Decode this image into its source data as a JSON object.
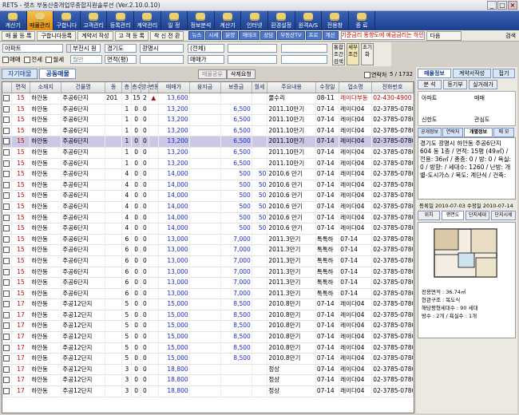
{
  "window": {
    "title": "RETS - 렛츠 부동산중개업무종합지원솔루션 (Ver.2.10.0.10)",
    "btn_min": "_",
    "btn_max": "□",
    "btn_close": "×"
  },
  "nav": [
    "계산기",
    "매물관리",
    "구합니다",
    "고객관리",
    "등록관리",
    "계약관리",
    "일 정",
    "정보분석",
    "계산기",
    "인터넷",
    "환경설정",
    "원격A/S",
    "전용창",
    "종 료"
  ],
  "subbar": {
    "b1": "매 물 등 록",
    "b2": "구합니다등록",
    "b3": "계약서 작성",
    "b4": "고 객 등 록",
    "b5": "착 신 전 환",
    "minis": [
      "뉴스",
      "시세",
      "분양",
      "재테크",
      "상담",
      "부동산TV",
      "프로",
      "계산"
    ],
    "ticker": "기준금리 동향도에 예금금리는 하인",
    "select": "다음",
    "search": "검색"
  },
  "filter": {
    "type": "아파트",
    "region": "부천시 원",
    "city": "경기도",
    "town": "광명시",
    "all": "(전체)",
    "cb1": "매매",
    "cb2": "전세",
    "cb3": "월세",
    "f1": "월반",
    "area": "면적(평)",
    "deal": "매매가",
    "v1": "통합조건검색",
    "v2": "세부조건",
    "v3": "초기화"
  },
  "tabs": {
    "t1": "자기매물",
    "t2": "공동매물",
    "b1": "매물공유",
    "b2": "삭제요청",
    "chk": "연락처",
    "count": "5 / 1732"
  },
  "columns": [
    "",
    "면적",
    "소재지",
    "건물명",
    "동",
    "층",
    "층수",
    "방수",
    "변동",
    "매매가",
    "융자금",
    "보증금",
    "월세",
    "주요내용",
    "수정일",
    "업소명",
    "전화번호"
  ],
  "rows": [
    [
      "15",
      "하안동",
      "주공6단지",
      "201",
      "3",
      "15",
      "2",
      "▲",
      "13,600",
      "",
      "",
      "",
      "물수리",
      "08-11",
      "레이다부동",
      "02-430-4900",
      "red"
    ],
    [
      "15",
      "하안동",
      "주공6단지",
      "",
      "1",
      "0",
      "0",
      "",
      "13,200",
      "",
      "6,500",
      "",
      "2011.10만기",
      "07-14",
      "레이다04",
      "02-3785-0780",
      ""
    ],
    [
      "15",
      "하안동",
      "주공6단지",
      "",
      "1",
      "0",
      "0",
      "",
      "13,200",
      "",
      "6,500",
      "",
      "2011.10만기",
      "07-14",
      "레이다04",
      "02-3785-0780",
      ""
    ],
    [
      "15",
      "하안동",
      "주공6단지",
      "",
      "1",
      "0",
      "0",
      "",
      "13,200",
      "",
      "6,500",
      "",
      "2011.10만기",
      "07-14",
      "레이다04",
      "02-3785-0780",
      ""
    ],
    [
      "15",
      "하안동",
      "주공6단지",
      "",
      "1",
      "0",
      "0",
      "",
      "13,200",
      "",
      "6,500",
      "",
      "2011.10만기",
      "07-14",
      "레이다04",
      "02-3785-0780",
      "sel"
    ],
    [
      "15",
      "하안동",
      "주공6단지",
      "",
      "1",
      "0",
      "0",
      "",
      "13,200",
      "",
      "6,500",
      "",
      "2011.10만기",
      "07-14",
      "레이다04",
      "02-3785-0780",
      ""
    ],
    [
      "15",
      "하안동",
      "주공6단지",
      "",
      "1",
      "0",
      "0",
      "",
      "13,200",
      "",
      "6,500",
      "",
      "2011.10만기",
      "07-14",
      "레이다04",
      "02-3785-0780",
      ""
    ],
    [
      "15",
      "하안동",
      "주공6단지",
      "",
      "4",
      "0",
      "0",
      "",
      "14,000",
      "",
      "500",
      "50",
      "2010.6 만기",
      "07-14",
      "레이다04",
      "02-3785-0780",
      ""
    ],
    [
      "15",
      "하안동",
      "주공6단지",
      "",
      "4",
      "0",
      "0",
      "",
      "14,000",
      "",
      "500",
      "50",
      "2010.6 만기",
      "07-14",
      "레이다04",
      "02-3785-0780",
      ""
    ],
    [
      "15",
      "하안동",
      "주공6단지",
      "",
      "4",
      "0",
      "0",
      "",
      "14,000",
      "",
      "500",
      "50",
      "2010.6 만기",
      "07-14",
      "레이다04",
      "02-3785-0780",
      ""
    ],
    [
      "15",
      "하안동",
      "주공6단지",
      "",
      "4",
      "0",
      "0",
      "",
      "14,000",
      "",
      "500",
      "50",
      "2010.6 만기",
      "07-14",
      "레이다04",
      "02-3785-0780",
      ""
    ],
    [
      "15",
      "하안동",
      "주공6단지",
      "",
      "4",
      "0",
      "0",
      "",
      "14,000",
      "",
      "500",
      "50",
      "2010.6 만기",
      "07-14",
      "레이다04",
      "02-3785-0780",
      ""
    ],
    [
      "15",
      "하안동",
      "주공6단지",
      "",
      "4",
      "0",
      "0",
      "",
      "14,000",
      "",
      "500",
      "50",
      "2010.6 만기",
      "07-14",
      "레이다04",
      "02-3785-0780",
      ""
    ],
    [
      "15",
      "하안동",
      "주공6단지",
      "",
      "6",
      "0",
      "0",
      "",
      "13,000",
      "",
      "7,000",
      "",
      "2011.3만기",
      "톡톡하",
      "07-14",
      "02-3785-0780",
      ""
    ],
    [
      "15",
      "하안동",
      "주공6단지",
      "",
      "6",
      "0",
      "0",
      "",
      "13,000",
      "",
      "7,000",
      "",
      "2011.3만기",
      "톡톡하",
      "07-14",
      "02-3785-0780",
      ""
    ],
    [
      "15",
      "하안동",
      "주공6단지",
      "",
      "6",
      "0",
      "0",
      "",
      "13,000",
      "",
      "7,000",
      "",
      "2011.3만기",
      "톡톡하",
      "07-14",
      "02-3785-0780",
      ""
    ],
    [
      "15",
      "하안동",
      "주공6단지",
      "",
      "6",
      "0",
      "0",
      "",
      "13,000",
      "",
      "7,000",
      "",
      "2011.3만기",
      "톡톡하",
      "07-14",
      "02-3785-0780",
      ""
    ],
    [
      "15",
      "하안동",
      "주공6단지",
      "",
      "6",
      "0",
      "0",
      "",
      "13,000",
      "",
      "7,000",
      "",
      "2011.3만기",
      "톡톡하",
      "07-14",
      "02-3785-0780",
      ""
    ],
    [
      "15",
      "하안동",
      "주공6단지",
      "",
      "6",
      "0",
      "0",
      "",
      "13,000",
      "",
      "7,000",
      "",
      "2011.3만기",
      "톡톡하",
      "07-14",
      "02-3785-0780",
      ""
    ],
    [
      "17",
      "하안동",
      "주공12단지",
      "",
      "5",
      "0",
      "0",
      "",
      "15,000",
      "",
      "8,500",
      "",
      "2010.8만기",
      "07-14",
      "레이다04",
      "02-3785-0780",
      ""
    ],
    [
      "17",
      "하안동",
      "주공12단지",
      "",
      "5",
      "0",
      "0",
      "",
      "15,000",
      "",
      "8,500",
      "",
      "2010.8만기",
      "07-14",
      "레이다04",
      "02-3785-0780",
      ""
    ],
    [
      "17",
      "하안동",
      "주공12단지",
      "",
      "5",
      "0",
      "0",
      "",
      "15,000",
      "",
      "8,500",
      "",
      "2010.8만기",
      "07-14",
      "레이다04",
      "02-3785-0780",
      ""
    ],
    [
      "17",
      "하안동",
      "주공12단지",
      "",
      "5",
      "0",
      "0",
      "",
      "15,000",
      "",
      "8,500",
      "",
      "2010.8만기",
      "07-14",
      "레이다04",
      "02-3785-0780",
      ""
    ],
    [
      "17",
      "하안동",
      "주공12단지",
      "",
      "5",
      "0",
      "0",
      "",
      "15,000",
      "",
      "8,500",
      "",
      "2010.8만기",
      "07-14",
      "레이다04",
      "02-3785-0780",
      ""
    ],
    [
      "17",
      "하안동",
      "주공12단지",
      "",
      "5",
      "0",
      "0",
      "",
      "15,000",
      "",
      "8,500",
      "",
      "2010.8만기",
      "07-14",
      "레이다04",
      "02-3785-0780",
      ""
    ],
    [
      "17",
      "하안동",
      "주공12단지",
      "",
      "3",
      "0",
      "0",
      "",
      "18,800",
      "",
      "",
      "",
      "정상",
      "07-14",
      "레이다04",
      "02-3785-0780",
      ""
    ],
    [
      "17",
      "하안동",
      "주공12단지",
      "",
      "3",
      "0",
      "0",
      "",
      "18,800",
      "",
      "",
      "",
      "정상",
      "07-14",
      "레이다04",
      "02-3785-0780",
      ""
    ],
    [
      "17",
      "하안동",
      "주공12단지",
      "",
      "3",
      "0",
      "0",
      "",
      "18,800",
      "",
      "",
      "",
      "정상",
      "07-14",
      "레이다04",
      "02-3785-0780",
      ""
    ]
  ],
  "panel": {
    "tabs": [
      "매물정보",
      "계약서작성",
      "접기"
    ],
    "sub": [
      "분 석",
      "등기부",
      "실거래가"
    ],
    "t1": "아파트",
    "t2": "매매",
    "t3": "신한도",
    "t4": "관심도",
    "info_tabs": [
      "공개정보",
      "연락처",
      "개별정보",
      "메 모"
    ],
    "detail": "경기도 광명시 하안동 주공6단지 604 동 1층 / 면적: 15평 (49㎡) / 전용: 36㎡ / 총층: 0 / 방: 0 / 욕실: 0 / 방향: / 세대수: 1260 / 난방: 개별-도시가스 / 복도: 계단식 / 건축:",
    "reg": "등록일 2010-07-03 수정일 2010-07-14",
    "view_tabs": [
      "위치",
      "평면도",
      "단지세대",
      "단지시세"
    ],
    "plan": [
      "전용면적 : 36.74㎡",
      "현관구조 : 복도식",
      "해당평형세대수 : 90 세대",
      "방수 : 2개 / 욕실수 : 1개"
    ]
  }
}
